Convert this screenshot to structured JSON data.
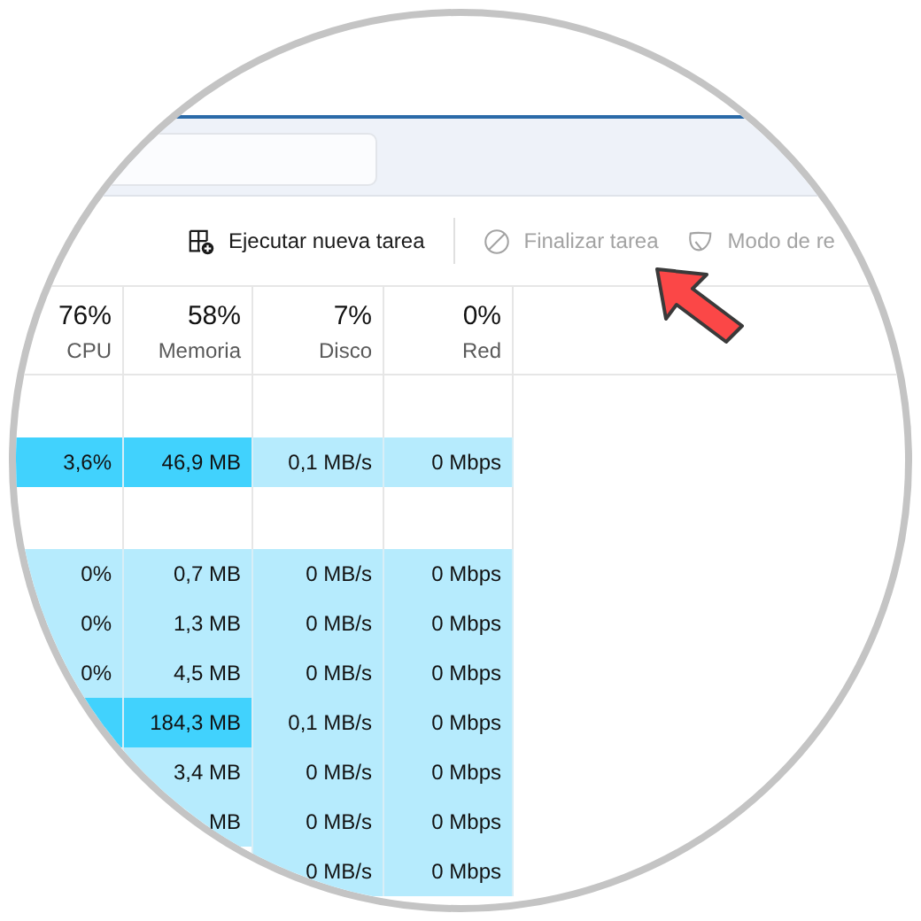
{
  "toolbar": {
    "buttons": [
      {
        "label": "Ejecutar nueva tarea",
        "kind": "run",
        "disabled": false
      },
      {
        "label": "Finalizar tarea",
        "kind": "end",
        "disabled": true
      },
      {
        "label": "Modo de re",
        "kind": "efficiency",
        "disabled": true
      }
    ]
  },
  "columns": [
    {
      "percent": "76%",
      "label": "CPU"
    },
    {
      "percent": "58%",
      "label": "Memoria"
    },
    {
      "percent": "7%",
      "label": "Disco"
    },
    {
      "percent": "0%",
      "label": "Red"
    }
  ],
  "rows": [
    {
      "kind": "blank"
    },
    {
      "kind": "data",
      "cells": [
        {
          "text": "3,6%",
          "color": "#41d2fd"
        },
        {
          "text": "46,9 MB",
          "color": "#41d2fd"
        },
        {
          "text": "0,1 MB/s",
          "color": "#b6ebfd"
        },
        {
          "text": "0 Mbps",
          "color": "#b6ebfd"
        }
      ]
    },
    {
      "kind": "blank"
    },
    {
      "kind": "data",
      "cells": [
        {
          "text": "0%",
          "color": "#b6ebfd"
        },
        {
          "text": "0,7 MB",
          "color": "#b6ebfd"
        },
        {
          "text": "0 MB/s",
          "color": "#b6ebfd"
        },
        {
          "text": "0 Mbps",
          "color": "#b6ebfd"
        }
      ]
    },
    {
      "kind": "data",
      "cells": [
        {
          "text": "0%",
          "color": "#b6ebfd"
        },
        {
          "text": "1,3 MB",
          "color": "#b6ebfd"
        },
        {
          "text": "0 MB/s",
          "color": "#b6ebfd"
        },
        {
          "text": "0 Mbps",
          "color": "#b6ebfd"
        }
      ]
    },
    {
      "kind": "data",
      "cells": [
        {
          "text": "0%",
          "color": "#b6ebfd"
        },
        {
          "text": "4,5 MB",
          "color": "#b6ebfd"
        },
        {
          "text": "0 MB/s",
          "color": "#b6ebfd"
        },
        {
          "text": "0 Mbps",
          "color": "#b6ebfd"
        }
      ]
    },
    {
      "kind": "data",
      "cells": [
        {
          "color": "#41d2fd"
        },
        {
          "text": "184,3 MB",
          "color": "#41d2fd"
        },
        {
          "text": "0,1 MB/s",
          "color": "#b6ebfd"
        },
        {
          "text": "0 Mbps",
          "color": "#b6ebfd"
        }
      ]
    },
    {
      "kind": "data",
      "cells": [
        null,
        {
          "text": "3,4 MB",
          "color": "#b6ebfd"
        },
        {
          "text": "0 MB/s",
          "color": "#b6ebfd"
        },
        {
          "text": "0 Mbps",
          "color": "#b6ebfd"
        }
      ]
    },
    {
      "kind": "data",
      "cells": [
        null,
        {
          "text": "MB",
          "color": "#b6ebfd"
        },
        {
          "text": "0 MB/s",
          "color": "#b6ebfd"
        },
        {
          "text": "0 Mbps",
          "color": "#b6ebfd"
        }
      ]
    },
    {
      "kind": "data",
      "cells": [
        null,
        null,
        {
          "text": "0 MB/s",
          "color": "#b6ebfd"
        },
        {
          "text": "0 Mbps",
          "color": "#b6ebfd"
        }
      ]
    }
  ]
}
